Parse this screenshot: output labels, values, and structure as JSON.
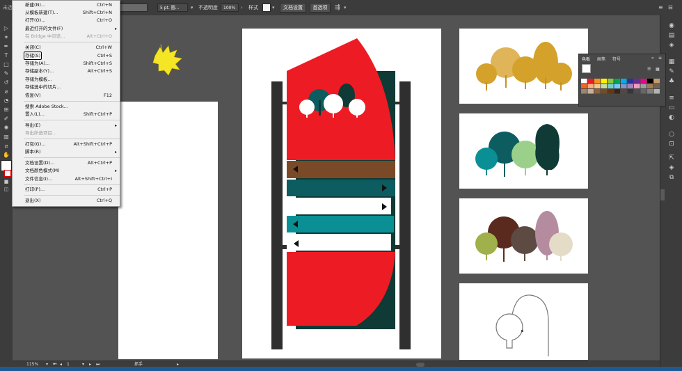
{
  "control_bar": {
    "left_label": "未选",
    "stroke_profile": "5 pt. 圆...",
    "opacity_label": "不透明度",
    "opacity_value": "100%",
    "style_label": "样式",
    "doc_setup_button": "文档设置",
    "prefs_button": "首选项"
  },
  "file_menu": {
    "items": [
      {
        "label": "新建(N)...",
        "shortcut": "Ctrl+N"
      },
      {
        "label": "从模板新建(T)...",
        "shortcut": "Shift+Ctrl+N"
      },
      {
        "label": "打开(O)...",
        "shortcut": "Ctrl+O"
      },
      {
        "label": "最近打开的文件(F)",
        "shortcut": "",
        "submenu": true
      },
      {
        "label": "在 Bridge 中浏览...",
        "shortcut": "Alt+Ctrl+O",
        "disabled": true
      },
      {
        "label": "关闭(C)",
        "shortcut": "Ctrl+W"
      },
      {
        "label": "存储(S)",
        "shortcut": "Ctrl+S",
        "selected": true
      },
      {
        "label": "存储为(A)...",
        "shortcut": "Shift+Ctrl+S"
      },
      {
        "label": "存储副本(Y)...",
        "shortcut": "Alt+Ctrl+S"
      },
      {
        "label": "存储为模板...",
        "shortcut": ""
      },
      {
        "label": "存储选中的切片...",
        "shortcut": ""
      },
      {
        "label": "恢复(V)",
        "shortcut": "F12"
      },
      {
        "label": "搜索 Adobe Stock...",
        "shortcut": ""
      },
      {
        "label": "置入(L)...",
        "shortcut": "Shift+Ctrl+P"
      },
      {
        "label": "导出(E)",
        "shortcut": "",
        "submenu": true
      },
      {
        "label": "导出所选项目...",
        "shortcut": "",
        "disabled": true
      },
      {
        "label": "打包(G)...",
        "shortcut": "Alt+Shift+Ctrl+P"
      },
      {
        "label": "脚本(R)",
        "shortcut": "",
        "submenu": true
      },
      {
        "label": "文档设置(D)...",
        "shortcut": "Alt+Ctrl+P"
      },
      {
        "label": "文档颜色模式(M)",
        "shortcut": "",
        "submenu": true
      },
      {
        "label": "文件信息(I)...",
        "shortcut": "Alt+Shift+Ctrl+I"
      },
      {
        "label": "打印(P)...",
        "shortcut": "Ctrl+P"
      },
      {
        "label": "退出(X)",
        "shortcut": "Ctrl+Q"
      }
    ]
  },
  "swatch_panel": {
    "tabs": [
      "色板",
      "画笔",
      "符号"
    ]
  },
  "status_bar": {
    "zoom": "115%",
    "artboard_number": "1",
    "tool_name": "抓手"
  },
  "colors": {
    "red": "#ed1c24",
    "dark_green": "#0f3a35",
    "teal": "#0d5c5f",
    "bright_teal": "#0a9094",
    "brown": "#7a4a28",
    "mustard": "#d4a22a",
    "light_green": "#9bd08b",
    "plum": "#5a2a1e",
    "mauve": "#b58b9f",
    "olive": "#a0b04a",
    "cream": "#e4dcc6",
    "yellow_leaf": "#f5e625"
  }
}
